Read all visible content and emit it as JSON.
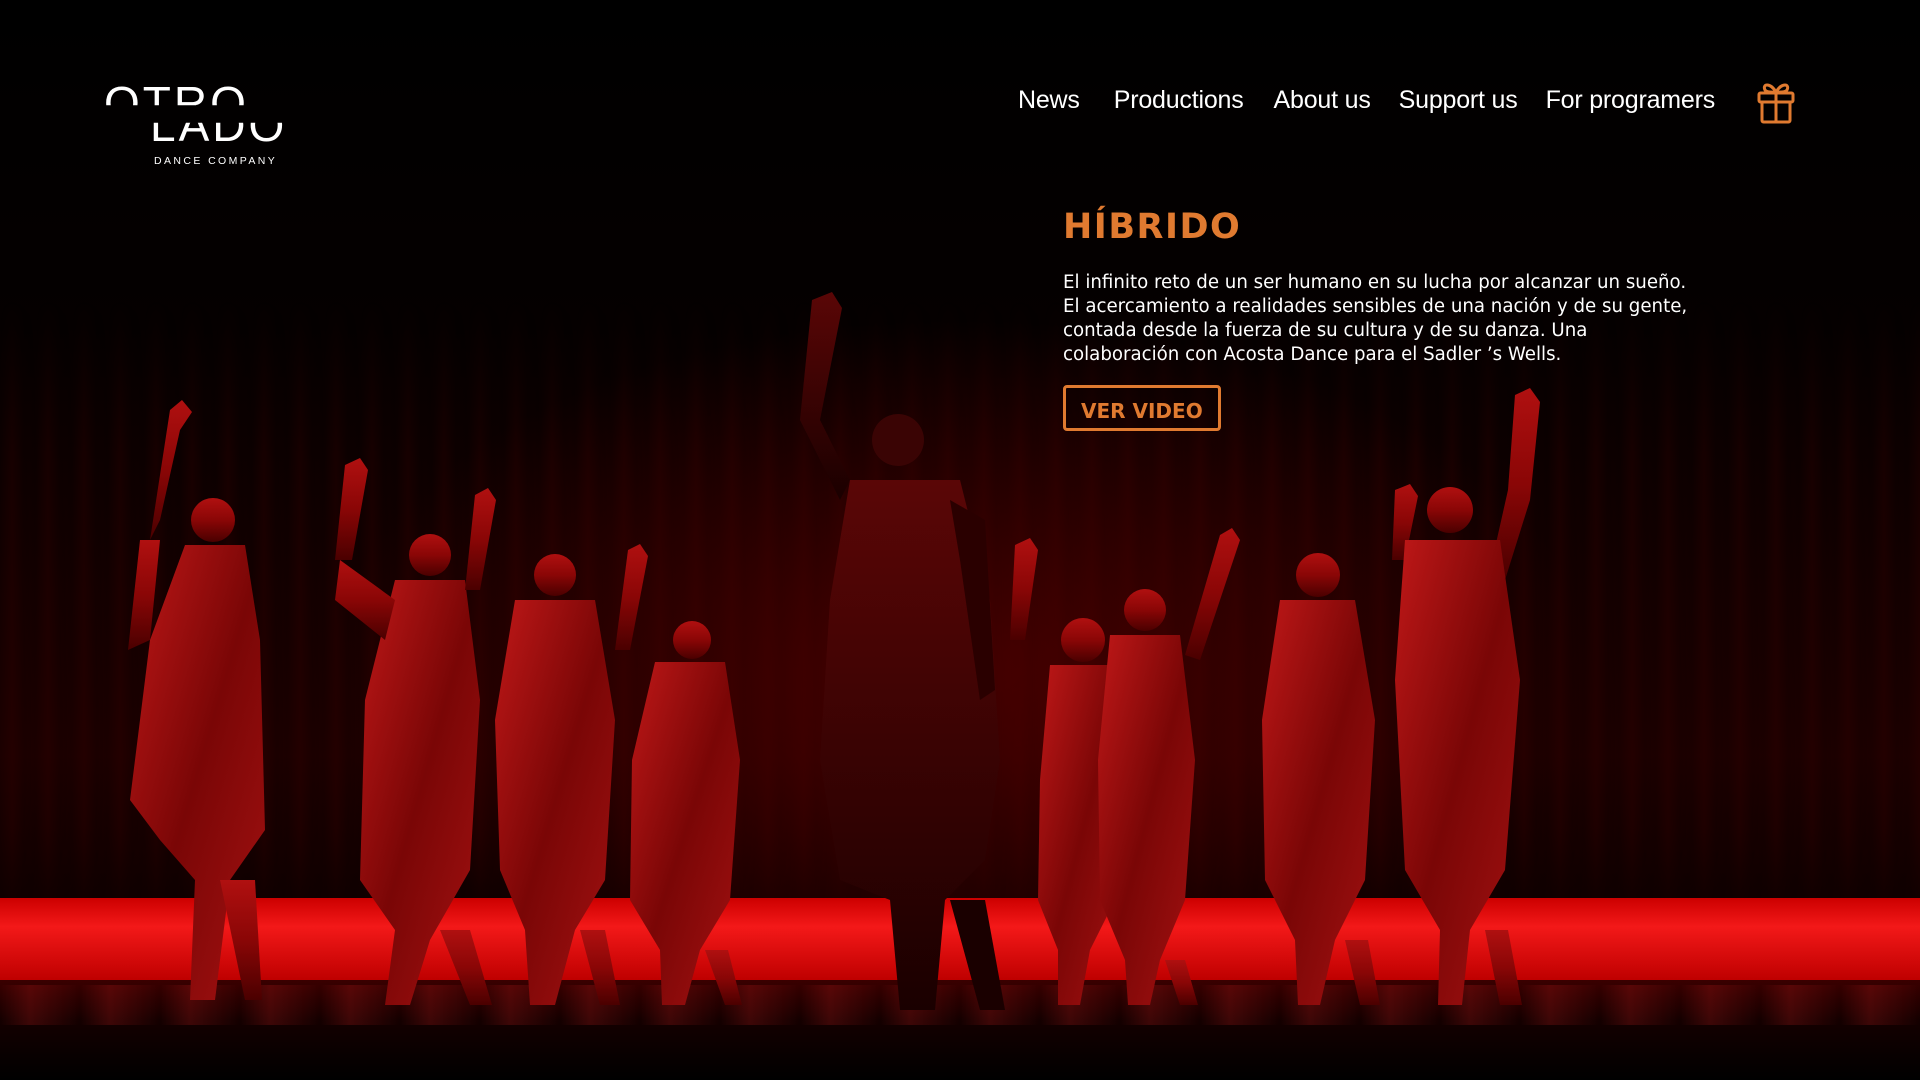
{
  "logo": {
    "line1": "OTRO",
    "line2": "LADO",
    "subtitle": "DANCE COMPANY"
  },
  "nav": {
    "items": [
      {
        "label": "News"
      },
      {
        "label": "Productions"
      },
      {
        "label": "About us"
      },
      {
        "label": "Support us"
      },
      {
        "label": "For programers"
      }
    ],
    "gift_icon": "gift-icon"
  },
  "hero": {
    "title": "HÍBRIDO",
    "description": "El infinito reto de un ser humano en su lucha por alcanzar un sueño. El acercamiento a realidades sensibles de una nación y de su gente, contada desde la fuerza de su cultura y de su danza. Una colaboración con Acosta Dance para el Sadler ’s Wells.",
    "button_label": "VER VIDEO"
  },
  "colors": {
    "accent": "#e07a30",
    "background": "#000000",
    "stage_red": "#e00000",
    "text": "#ffffff"
  }
}
